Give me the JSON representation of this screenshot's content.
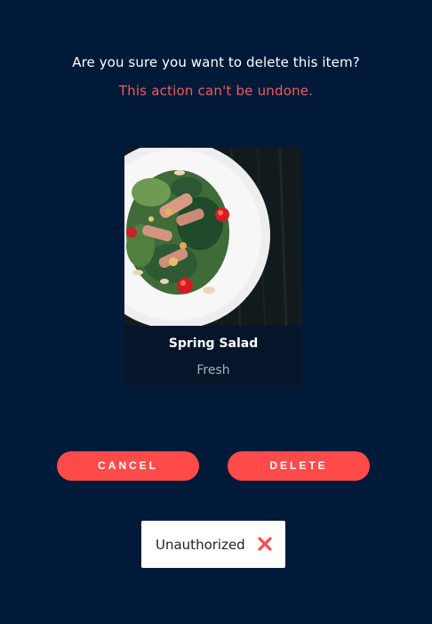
{
  "dialog": {
    "question": "Are you sure you want to delete this item?",
    "warning": "This action can't be undone."
  },
  "item": {
    "name": "Spring Salad",
    "tag": "Fresh"
  },
  "actions": {
    "cancel_label": "CANCEL",
    "delete_label": "DELETE"
  },
  "toast": {
    "message": "Unauthorized",
    "close_icon": "close-x-icon"
  },
  "colors": {
    "background": "#011a3a",
    "accent": "#ff4a4a",
    "warning_text": "#f05a5a",
    "card_footer": "#06152a"
  }
}
